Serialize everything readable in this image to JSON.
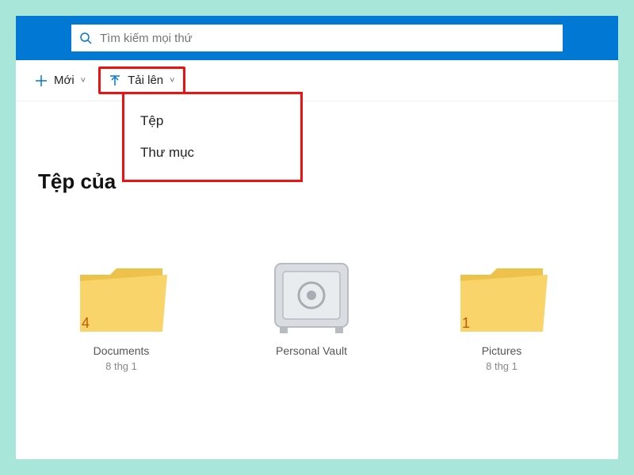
{
  "search": {
    "placeholder": "Tìm kiếm mọi thứ"
  },
  "toolbar": {
    "new_label": "Mới",
    "upload_label": "Tải lên"
  },
  "upload_menu": {
    "file": "Tệp",
    "folder": "Thư mục"
  },
  "page_title": "Tệp của",
  "files": [
    {
      "name": "Documents",
      "date": "8 thg 1",
      "badge": "4",
      "kind": "folder"
    },
    {
      "name": "Personal Vault",
      "date": "",
      "badge": "",
      "kind": "vault"
    },
    {
      "name": "Pictures",
      "date": "8 thg 1",
      "badge": "1",
      "kind": "folder"
    }
  ],
  "colors": {
    "accent": "#0078d4",
    "highlight": "#e11"
  }
}
